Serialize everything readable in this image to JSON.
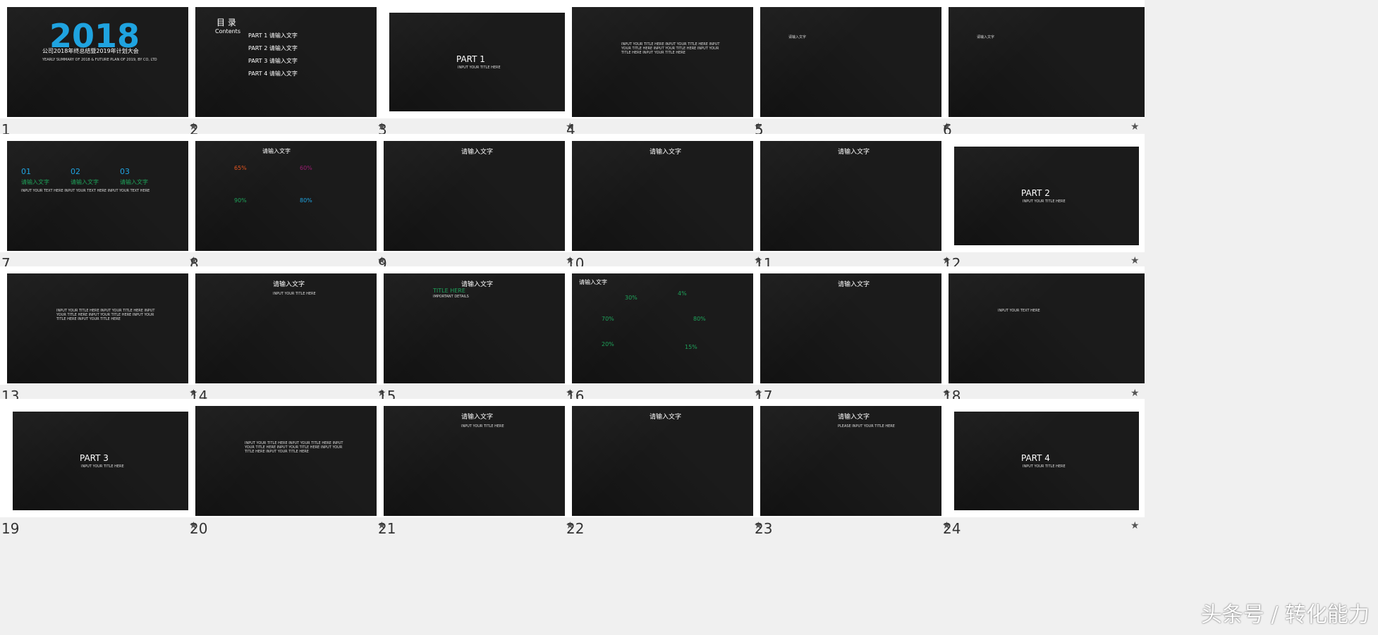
{
  "slides": [
    {
      "n": "1",
      "title": "公司2018年终总结暨2019年计划大会",
      "big": "2018",
      "sub": "YEARLY SUMMARY OF 2018 & FUTURE PLAN OF 2019, BY CO, LTD"
    },
    {
      "n": "2",
      "toc_title": "目 录",
      "toc_en": "Contents",
      "items": [
        "PART 1  请输入文字",
        "PART 2  请输入文字",
        "PART 3  请输入文字",
        "PART 4  请输入文字"
      ]
    },
    {
      "n": "3",
      "part": "PART 1",
      "sub": "INPUT YOUR TITLE HERE"
    },
    {
      "n": "4",
      "text": "INPUT YOUR TITLE HERE  INPUT YOUR TITLE HERE  INPUT YOUR TITLE HERE  INPUT YOUR TITLE HERE  INPUT YOUR TITLE HERE  INPUT YOUR TITLE HERE"
    },
    {
      "n": "5",
      "label": "请输入文字"
    },
    {
      "n": "6",
      "label": "请输入文字"
    },
    {
      "n": "7",
      "cols": [
        {
          "num": "01",
          "t": "请输入文字"
        },
        {
          "num": "02",
          "t": "请输入文字"
        },
        {
          "num": "03",
          "t": "请输入文字"
        }
      ],
      "body": "INPUT YOUR TEXT HERE INPUT YOUR TEXT HERE INPUT YOUR TEXT HERE"
    },
    {
      "n": "8",
      "title": "请输入文字",
      "p1": "65%",
      "p2": "60%",
      "p3": "90%",
      "p4": "80%"
    },
    {
      "n": "9",
      "title": "请输入文字"
    },
    {
      "n": "10",
      "title": "请输入文字"
    },
    {
      "n": "11",
      "title": "请输入文字"
    },
    {
      "n": "12",
      "part": "PART 2",
      "sub": "INPUT YOUR TITLE HERE"
    },
    {
      "n": "13",
      "text": "INPUT YOUR TITLE HERE  INPUT YOUR TITLE HERE  INPUT YOUR TITLE HERE  INPUT YOUR TITLE HERE  INPUT YOUR TITLE HERE  INPUT YOUR TITLE HERE"
    },
    {
      "n": "14",
      "title": "请输入文字",
      "sub": "INPUT YOUR TITLE HERE"
    },
    {
      "n": "15",
      "title": "请输入文字",
      "t2": "TITLE HERE",
      "t3": "IMPORTANT DETAILS"
    },
    {
      "n": "16",
      "title": "请输入文字",
      "p1": "30%",
      "p2": "4%",
      "p3": "70%",
      "p4": "80%",
      "p5": "20%",
      "p6": "15%"
    },
    {
      "n": "17",
      "title": "请输入文字"
    },
    {
      "n": "18",
      "text": "INPUT YOUR TEXT HERE"
    },
    {
      "n": "19",
      "part": "PART 3",
      "sub": "INPUT YOUR TITLE HERE"
    },
    {
      "n": "20",
      "text": "INPUT YOUR TITLE HERE  INPUT YOUR TITLE HERE  INPUT YOUR TITLE HERE  INPUT YOUR TITLE HERE  INPUT YOUR TITLE HERE  INPUT YOUR TITLE HERE"
    },
    {
      "n": "21",
      "title": "请输入文字",
      "sub": "INPUT YOUR TITLE HERE"
    },
    {
      "n": "22",
      "title": "请输入文字"
    },
    {
      "n": "23",
      "title": "请输入文字",
      "sub": "PLEASE INPUT YOUR TITLE HERE"
    },
    {
      "n": "24",
      "part": "PART 4",
      "sub": "INPUT YOUR TITLE HERE"
    }
  ],
  "watermark": "头条号 / 转化能力",
  "star_icon": "star-icon"
}
